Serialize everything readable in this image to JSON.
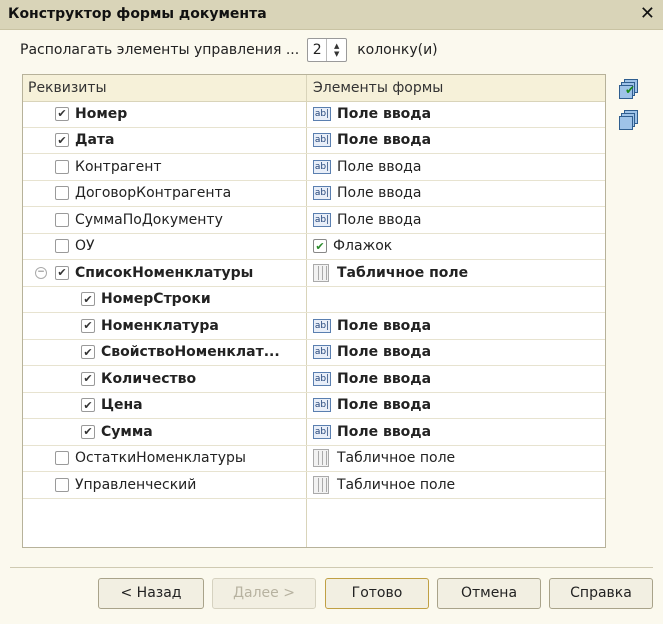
{
  "window": {
    "title": "Конструктор формы документа",
    "close_glyph": "✕"
  },
  "options": {
    "label": "Располагать элементы управления ...",
    "columns_value": "2",
    "columns_suffix": "колонку(и)"
  },
  "grid": {
    "col1_header": "Реквизиты",
    "col2_header": "Элементы формы",
    "rows": [
      {
        "name": "Номер",
        "checked": true,
        "bold": true,
        "indent": 0,
        "element": "Поле ввода",
        "element_type": "input",
        "element_bold": true
      },
      {
        "name": "Дата",
        "checked": true,
        "bold": true,
        "indent": 0,
        "element": "Поле ввода",
        "element_type": "input",
        "element_bold": true
      },
      {
        "name": "Контрагент",
        "checked": false,
        "bold": false,
        "indent": 0,
        "element": "Поле ввода",
        "element_type": "input",
        "element_bold": false
      },
      {
        "name": "ДоговорКонтрагента",
        "checked": false,
        "bold": false,
        "indent": 0,
        "element": "Поле ввода",
        "element_type": "input",
        "element_bold": false
      },
      {
        "name": "СуммаПоДокументу",
        "checked": false,
        "bold": false,
        "indent": 0,
        "element": "Поле ввода",
        "element_type": "input",
        "element_bold": false
      },
      {
        "name": "ОУ",
        "checked": false,
        "bold": false,
        "indent": 0,
        "element": "Флажок",
        "element_type": "checkbox",
        "element_bold": false
      },
      {
        "name": "СписокНоменклатуры",
        "checked": true,
        "bold": true,
        "indent": 0,
        "collapse": true,
        "element": "Табличное поле",
        "element_type": "table",
        "element_bold": true
      },
      {
        "name": "НомерСтроки",
        "checked": true,
        "bold": true,
        "indent": 1,
        "element": "",
        "element_type": "none",
        "element_bold": false
      },
      {
        "name": "Номенклатура",
        "checked": true,
        "bold": true,
        "indent": 1,
        "element": "Поле ввода",
        "element_type": "input",
        "element_bold": true
      },
      {
        "name": "СвойствоНоменклат...",
        "checked": true,
        "bold": true,
        "indent": 1,
        "element": "Поле ввода",
        "element_type": "input",
        "element_bold": true
      },
      {
        "name": "Количество",
        "checked": true,
        "bold": true,
        "indent": 1,
        "element": "Поле ввода",
        "element_type": "input",
        "element_bold": true
      },
      {
        "name": "Цена",
        "checked": true,
        "bold": true,
        "indent": 1,
        "element": "Поле ввода",
        "element_type": "input",
        "element_bold": true
      },
      {
        "name": "Сумма",
        "checked": true,
        "bold": true,
        "indent": 1,
        "element": "Поле ввода",
        "element_type": "input",
        "element_bold": true
      },
      {
        "name": "ОстаткиНоменклатуры",
        "checked": false,
        "bold": false,
        "indent": 0,
        "element": "Табличное поле",
        "element_type": "table",
        "element_bold": false
      },
      {
        "name": "Управленческий",
        "checked": false,
        "bold": false,
        "indent": 0,
        "element": "Табличное поле",
        "element_type": "table",
        "element_bold": false
      }
    ]
  },
  "buttons": {
    "back": "< Назад",
    "next": "Далее >",
    "done": "Готово",
    "cancel": "Отмена",
    "help": "Справка"
  },
  "icons": {
    "input_badge": "ab|",
    "check_all": "check-all-icon",
    "uncheck_all": "uncheck-all-icon"
  }
}
